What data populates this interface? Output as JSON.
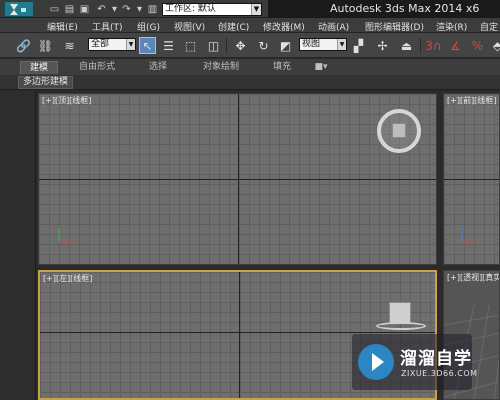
{
  "title_bar": {
    "workspace_label": "工作区: 默认",
    "app_title": "Autodesk 3ds Max  2014 x6"
  },
  "quick_access": {
    "icons": [
      "new-file-icon",
      "open-file-icon",
      "save-icon",
      "undo-icon",
      "redo-icon",
      "project-folder-icon"
    ]
  },
  "menu": {
    "items": [
      "编辑(E)",
      "工具(T)",
      "组(G)",
      "视图(V)",
      "创建(C)",
      "修改器(M)",
      "动画(A)",
      "图形编辑器(D)",
      "渲染(R)",
      "自定"
    ]
  },
  "toolbar": {
    "selection_filter": "全部",
    "reference_coord": "视图"
  },
  "ribbon": {
    "tabs": [
      "建模",
      "自由形式",
      "选择",
      "对象绘制",
      "填充",
      "■▾"
    ],
    "active_tab": "建模",
    "panel_label": "多边形建模"
  },
  "viewports": {
    "top": "[+][顶][线框]",
    "front": "[+][前][线框]",
    "left": "[+][左][线框]",
    "perspective": "[+][透视][真实"
  },
  "watermark": {
    "title": "溜溜自学",
    "subtitle": "ZIXUE.3D66.COM"
  },
  "colors": {
    "active_viewport_border": "#c8a14b",
    "title_bar": "#1a1a1a",
    "viewport_grid": "#6e6e6e",
    "watermark_accent": "#2d86c4"
  }
}
